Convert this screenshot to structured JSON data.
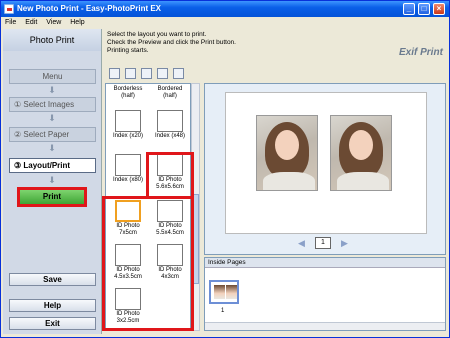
{
  "window": {
    "title": "New Photo Print - Easy-PhotoPrint EX"
  },
  "menu": [
    "File",
    "Edit",
    "View",
    "Help"
  ],
  "sidebar": {
    "header": "Photo Print",
    "steps": [
      {
        "label": "Menu"
      },
      {
        "label": "① Select Images"
      },
      {
        "label": "② Select Paper"
      },
      {
        "label": "③ Layout/Print"
      }
    ],
    "print_label": "Print",
    "save_label": "Save",
    "help_label": "Help",
    "exit_label": "Exit"
  },
  "instructions": {
    "line1": "Select the layout you want to print.",
    "line2": "Check the Preview and click the Print button.",
    "line3": "Printing starts."
  },
  "brand": "Exif Print",
  "layouts": [
    {
      "label": "Borderless (half)"
    },
    {
      "label": "Bordered (half)"
    },
    {
      "label": "Index (x20)"
    },
    {
      "label": "Index (x48)"
    },
    {
      "label": "Index (x80)"
    },
    {
      "label": "ID Photo 5.6x5.6cm"
    },
    {
      "label": "ID Photo 7x5cm"
    },
    {
      "label": "ID Photo 5.5x4.5cm"
    },
    {
      "label": "ID Photo 4.5x3.5cm"
    },
    {
      "label": "ID Photo 4x3cm"
    },
    {
      "label": "ID Photo 3x2.5cm"
    }
  ],
  "preview": {
    "page_number": "1"
  },
  "inside_pages": {
    "header": "Inside Pages",
    "thumb_number": "1"
  }
}
